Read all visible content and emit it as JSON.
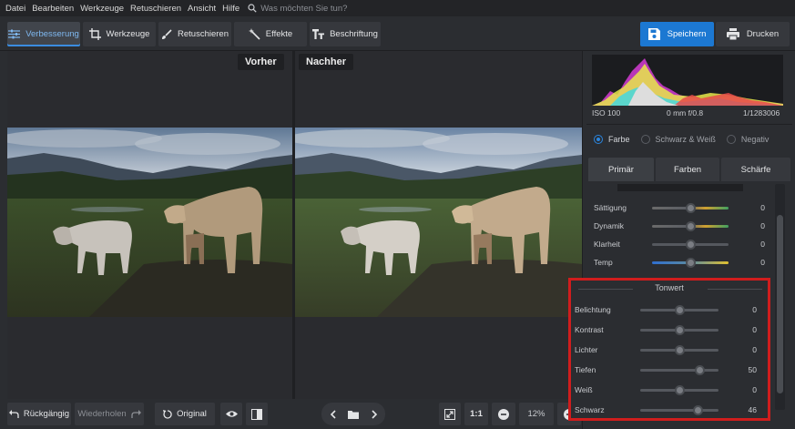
{
  "menu": [
    "Datei",
    "Bearbeiten",
    "Werkzeuge",
    "Retuschieren",
    "Ansicht",
    "Hilfe"
  ],
  "search": {
    "placeholder": "Was möchten Sie tun?"
  },
  "toolbar": {
    "tabs": [
      {
        "label": "Verbesserung",
        "icon": "sliders-icon"
      },
      {
        "label": "Werkzeuge",
        "icon": "crop-icon"
      },
      {
        "label": "Retuschieren",
        "icon": "brush-icon"
      },
      {
        "label": "Effekte",
        "icon": "magic-wand-icon"
      },
      {
        "label": "Beschriftung",
        "icon": "text-icon"
      }
    ],
    "save_label": "Speichern",
    "print_label": "Drucken"
  },
  "canvas": {
    "before_label": "Vorher",
    "after_label": "Nachher"
  },
  "bottom": {
    "undo_label": "Rückgängig",
    "redo_label": "Wiederholen",
    "original_label": "Original",
    "one_to_one": "1:1",
    "zoom": "12%"
  },
  "panel": {
    "exif": {
      "iso": "ISO 100",
      "lens": "0 mm f/0.8",
      "shutter": "1/1283006"
    },
    "modes": [
      {
        "label": "Farbe",
        "selected": true
      },
      {
        "label": "Schwarz & Weiß",
        "selected": false
      },
      {
        "label": "Negativ",
        "selected": false
      }
    ],
    "tabs": [
      "Primär",
      "Farben",
      "Schärfe"
    ],
    "color_sliders": [
      {
        "label": "Sättigung",
        "value": "0",
        "level": 0.5
      },
      {
        "label": "Dynamik",
        "value": "0",
        "level": 0.5
      },
      {
        "label": "Klarheit",
        "value": "0",
        "level": 0.5
      },
      {
        "label": "Temp",
        "value": "0",
        "level": 0.5
      }
    ],
    "tonwert": {
      "title": "Tonwert",
      "sliders": [
        {
          "label": "Belichtung",
          "value": "0",
          "level": 0.5
        },
        {
          "label": "Kontrast",
          "value": "0",
          "level": 0.5
        },
        {
          "label": "Lichter",
          "value": "0",
          "level": 0.5
        },
        {
          "label": "Tiefen",
          "value": "50",
          "level": 0.75
        },
        {
          "label": "Weiß",
          "value": "0",
          "level": 0.5
        },
        {
          "label": "Schwarz",
          "value": "46",
          "level": 0.73
        }
      ]
    }
  },
  "colors": {
    "accent": "#1c78d2",
    "highlight_box": "#d01d1d"
  }
}
